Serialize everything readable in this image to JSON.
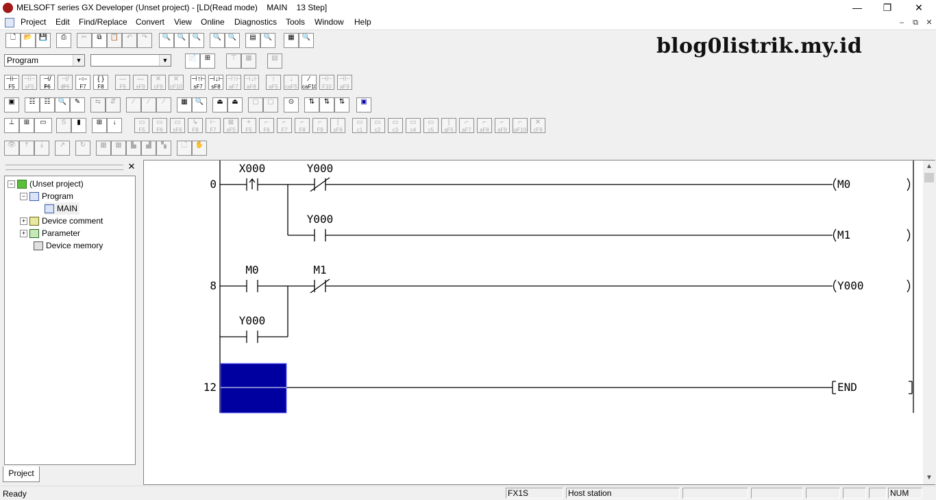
{
  "window": {
    "title": "MELSOFT series GX Developer (Unset project) - [LD(Read mode)    MAIN    13 Step]",
    "minimize": "—",
    "maximize": "❐",
    "close": "✕"
  },
  "menu": {
    "items": [
      "Project",
      "Edit",
      "Find/Replace",
      "Convert",
      "View",
      "Online",
      "Diagnostics",
      "Tools",
      "Window",
      "Help"
    ],
    "mdi_minimize": "–",
    "mdi_restore": "⧉",
    "mdi_close": "✕"
  },
  "toolbar": {
    "program_select": "Program",
    "second_select": "",
    "ladder_symbols": [
      {
        "glyph": "⊣⊢",
        "key": "F5"
      },
      {
        "glyph": "⊣⊢",
        "key": "sF5"
      },
      {
        "glyph": "⊣/⊢",
        "key": "F6"
      },
      {
        "glyph": "⊣/⊢",
        "key": "sF6"
      },
      {
        "glyph": "-○-",
        "key": "F7"
      },
      {
        "glyph": "{ }",
        "key": "F8"
      },
      {
        "glyph": "—",
        "key": "F9"
      },
      {
        "glyph": "—",
        "key": "sF9"
      },
      {
        "glyph": "✕",
        "key": "cF9"
      },
      {
        "glyph": "✕",
        "key": "cF10"
      },
      {
        "glyph": "⊣↑⊢",
        "key": "sF7"
      },
      {
        "glyph": "⊣↓⊢",
        "key": "sF8"
      },
      {
        "glyph": "⊣↑⊢",
        "key": "aF7"
      },
      {
        "glyph": "⊣↓⊢",
        "key": "aF8"
      },
      {
        "glyph": "↑",
        "key": "aF5"
      },
      {
        "glyph": "↓",
        "key": "caF5"
      },
      {
        "glyph": "⁄",
        "key": "caF10"
      },
      {
        "glyph": "⊣⊢",
        "key": "F10"
      },
      {
        "glyph": "⊣⊢",
        "key": "aF9"
      }
    ],
    "row5_keys": [
      "F5",
      "F6",
      "sF6",
      "F8",
      "F7",
      "sF5",
      "F5",
      "F6",
      "F7",
      "F8",
      "F9",
      "sF9",
      "c1",
      "c2",
      "c3",
      "c4",
      "c5",
      "aF5",
      "aF7",
      "aF8",
      "aF9",
      "aF10",
      "cF9"
    ]
  },
  "brand": "blog0listrik.my.id",
  "project_panel": {
    "close": "✕",
    "tab_label": "Project",
    "tree": [
      {
        "label": "(Unset project)",
        "expander": "−"
      },
      {
        "label": "Program",
        "expander": "−"
      },
      {
        "label": "MAIN",
        "expander": ""
      },
      {
        "label": "Device comment",
        "expander": "+"
      },
      {
        "label": "Parameter",
        "expander": "+"
      },
      {
        "label": "Device memory",
        "expander": ""
      }
    ]
  },
  "ladder": {
    "step_numbers": [
      "0",
      "8",
      "12"
    ],
    "contacts": [
      "X000",
      "Y000",
      "Y000",
      "M0",
      "M1",
      "Y000"
    ],
    "coils": [
      "M0",
      "M1",
      "Y000"
    ],
    "end_instruction": "END"
  },
  "status": {
    "ready": "Ready",
    "plc_type": "FX1S",
    "station": "Host station",
    "num": "NUM"
  }
}
